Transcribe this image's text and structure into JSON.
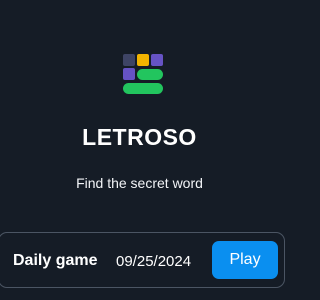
{
  "app": {
    "title": "LETROSO",
    "tagline": "Find the secret word"
  },
  "logo": {
    "icon": "letroso-logo-icon",
    "colors": {
      "gray": "#3e4465",
      "yellow": "#f3b400",
      "purple": "#6653c4",
      "green": "#22c55e"
    }
  },
  "daily": {
    "label": "Daily game",
    "date": "09/25/2024",
    "play_label": "Play"
  },
  "colors": {
    "background": "#151c26",
    "card_border": "#4b5563",
    "accent": "#0a8ff0",
    "text": "#ffffff"
  }
}
